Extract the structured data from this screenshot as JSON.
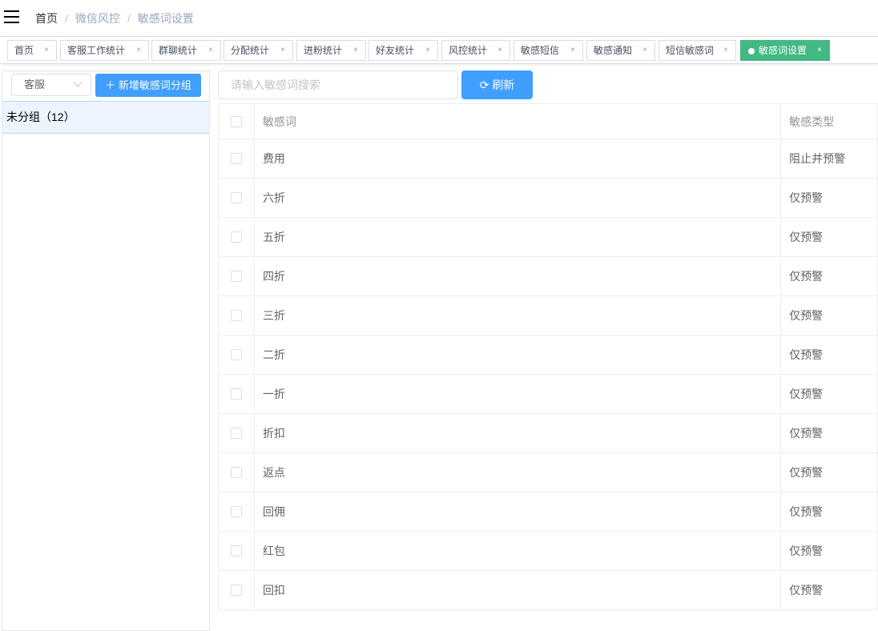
{
  "breadcrumb": [
    "首页",
    "微信风控",
    "敏感词设置"
  ],
  "tabs": [
    {
      "label": "首页"
    },
    {
      "label": "客服工作统计"
    },
    {
      "label": "群聊统计"
    },
    {
      "label": "分配统计"
    },
    {
      "label": "进粉统计"
    },
    {
      "label": "好友统计"
    },
    {
      "label": "风控统计"
    },
    {
      "label": "敏感短信"
    },
    {
      "label": "敏感通知"
    },
    {
      "label": "短信敏感词"
    },
    {
      "label": "敏感词设置",
      "active": true
    }
  ],
  "close_glyph": "×",
  "left": {
    "select_value": "客服",
    "add_button": "新增敏感词分组",
    "groups": [
      "未分组（12）"
    ]
  },
  "search": {
    "placeholder": "请输入敏感词搜索",
    "value": ""
  },
  "refresh_label": "刷新",
  "table": {
    "headers": [
      "敏感词",
      "敏感类型"
    ],
    "rows": [
      [
        "费用",
        "阻止并预警"
      ],
      [
        "六折",
        "仅预警"
      ],
      [
        "五折",
        "仅预警"
      ],
      [
        "四折",
        "仅预警"
      ],
      [
        "三折",
        "仅预警"
      ],
      [
        "二折",
        "仅预警"
      ],
      [
        "一折",
        "仅预警"
      ],
      [
        "折扣",
        "仅预警"
      ],
      [
        "返点",
        "仅预警"
      ],
      [
        "回佣",
        "仅预警"
      ],
      [
        "红包",
        "仅预警"
      ],
      [
        "回扣",
        "仅预警"
      ]
    ]
  },
  "colors": {
    "primary": "#409eff",
    "active_tab": "#42b983"
  }
}
